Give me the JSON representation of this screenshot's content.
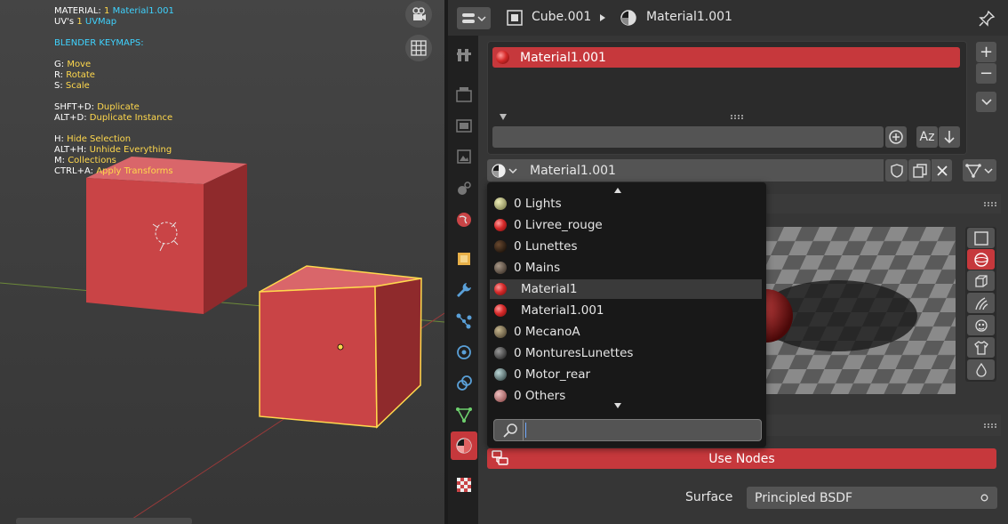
{
  "viewport": {
    "overlay": {
      "material_label": "MATERIAL:",
      "material_count": "1",
      "material_name": "Material1.001",
      "uv_label": "UV's",
      "uv_count": "1",
      "uv_name": "UVMap",
      "keymaps_title": "BLENDER KEYMAPS:",
      "shortcuts": [
        {
          "key": "G:",
          "action": "Move"
        },
        {
          "key": "R:",
          "action": "Rotate"
        },
        {
          "key": "S:",
          "action": "Scale"
        },
        {
          "key": "SHFT+D:",
          "action": "Duplicate"
        },
        {
          "key": "ALT+D:",
          "action": "Duplicate Instance"
        },
        {
          "key": "H:",
          "action": "Hide Selection"
        },
        {
          "key": "ALT+H:",
          "action": "Unhide Everything"
        },
        {
          "key": "M:",
          "action": "Collections"
        },
        {
          "key": "CTRL+A:",
          "action": "Apply Transforms"
        }
      ]
    }
  },
  "header": {
    "object_name": "Cube.001",
    "material_name": "Material1.001"
  },
  "slots": {
    "items": [
      "Material1.001"
    ],
    "add_symbol": "+",
    "remove_symbol": "−",
    "sort_label": "Az"
  },
  "material_selector": {
    "current": "Material1.001"
  },
  "dropdown": {
    "items": [
      {
        "label": "0 Lights",
        "color": "#cfcf9a",
        "selected": false
      },
      {
        "label": "0 Livree_rouge",
        "color": "#d62a2a",
        "selected": false
      },
      {
        "label": "0 Lunettes",
        "color": "#2a1a10",
        "selected": false
      },
      {
        "label": "0 Mains",
        "color": "#6a5a50",
        "selected": false
      },
      {
        "label": "Material1",
        "color": "#d62a2a",
        "selected": true
      },
      {
        "label": "Material1.001",
        "color": "#d62a2a",
        "selected": false
      },
      {
        "label": "0 MecanoA",
        "color": "#8a7a5a",
        "selected": false
      },
      {
        "label": "0 MonturesLunettes",
        "color": "#5a5a5a",
        "selected": false
      },
      {
        "label": "0 Motor_rear",
        "color": "#6a8a8a",
        "selected": false
      },
      {
        "label": "0 Others",
        "color": "#d08080",
        "selected": false
      }
    ],
    "search_value": ""
  },
  "use_nodes_label": "Use Nodes",
  "surface": {
    "label": "Surface",
    "value": "Principled BSDF"
  },
  "colors": {
    "accent_red": "#c6383c",
    "selection_yellow": "#ffd84d",
    "overlay_cyan": "#3fd3ff"
  }
}
